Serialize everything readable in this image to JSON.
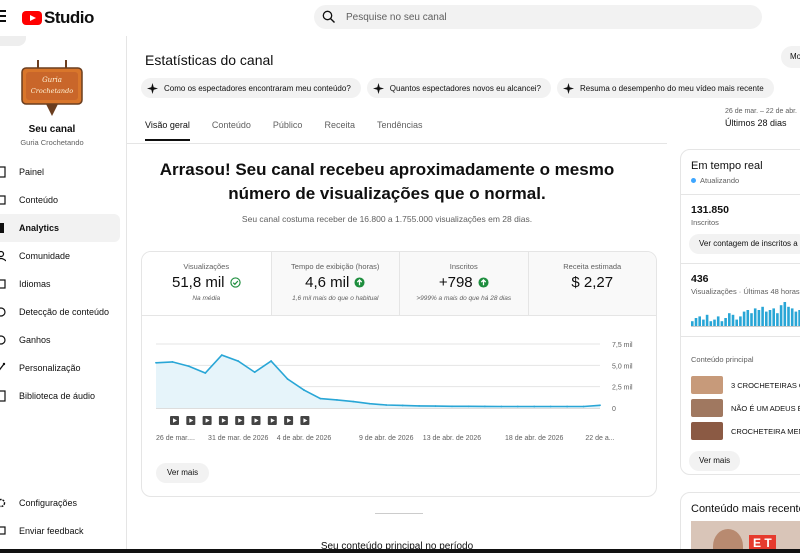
{
  "app": {
    "logo_text": "Studio"
  },
  "search": {
    "placeholder": "Pesquise no seu canal"
  },
  "sidebar": {
    "avatar_text_1": "Guria",
    "avatar_text_2": "Crochetando",
    "channel_label": "Seu canal",
    "channel_name": "Guria Crochetando",
    "items": [
      {
        "label": "Painel",
        "icon": "dashboard-icon"
      },
      {
        "label": "Conteúdo",
        "icon": "content-icon"
      },
      {
        "label": "Analytics",
        "icon": "analytics-icon",
        "active": true
      },
      {
        "label": "Comunidade",
        "icon": "community-icon"
      },
      {
        "label": "Idiomas",
        "icon": "subtitles-icon"
      },
      {
        "label": "Detecção de conteúdo",
        "icon": "copyright-icon"
      },
      {
        "label": "Ganhos",
        "icon": "earn-icon"
      },
      {
        "label": "Personalização",
        "icon": "magic-icon"
      },
      {
        "label": "Biblioteca de áudio",
        "icon": "audio-library-icon"
      }
    ],
    "bottom_items": [
      {
        "label": "Configurações",
        "icon": "gear-icon"
      },
      {
        "label": "Enviar feedback",
        "icon": "feedback-icon"
      }
    ]
  },
  "main": {
    "title": "Estatísticas do canal",
    "more_button": "Mo",
    "chips": [
      "Como os espectadores encontraram meu conteúdo?",
      "Quantos espectadores novos eu alcancei?",
      "Resuma o desempenho do meu vídeo mais recente"
    ],
    "tabs": [
      "Visão geral",
      "Conteúdo",
      "Público",
      "Receita",
      "Tendências"
    ],
    "date_small": "26 de mar. – 22 de abr.",
    "date_range": "Últimos 28 dias",
    "headline_1": "Arrasou! Seu canal recebeu aproximadamente o mesmo",
    "headline_2": "número de visualizações que o normal.",
    "subline": "Seu canal costuma receber de 16.800 a 1.755.000 visualizações em 28 dias.",
    "metrics": [
      {
        "label": "Visualizações",
        "value": "51,8 mil",
        "note": "Na média",
        "badge": "check-circle-icon"
      },
      {
        "label": "Tempo de exibição (horas)",
        "value": "4,6 mil",
        "note": "1,6 mil mais do que o habitual",
        "badge": "arrow-up-icon"
      },
      {
        "label": "Inscritos",
        "value": "+798",
        "note": ">999% a mais do que há 28 dias",
        "badge": "arrow-up-icon"
      },
      {
        "label": "Receita estimada",
        "value": "$ 2,27",
        "note": ""
      }
    ],
    "see_more": "Ver mais",
    "bottom_title": "Seu conteúdo principal no período",
    "colors": {
      "accent": "#0f0f0f",
      "chart_line": "#29a6d6",
      "chart_fill": "#e6f4fa",
      "green": "#1e8e3e",
      "red": "#ff0000"
    }
  },
  "chart_data": {
    "type": "area",
    "x_tick_labels": [
      "26 de mar....",
      "31 de mar. de 2026",
      "4 de abr. de 2026",
      "9 de abr. de 2026",
      "13 de abr. de 2026",
      "18 de abr. de 2026",
      "22 de a..."
    ],
    "x_tick_index": [
      0,
      5,
      9,
      14,
      18,
      23,
      27
    ],
    "y_tick_labels": [
      "7,5 mil",
      "5,0 mil",
      "2,5 mil",
      "0"
    ],
    "y_ticks": [
      7500,
      5000,
      2500,
      0
    ],
    "ylim": [
      0,
      7500
    ],
    "series": [
      {
        "values": [
          5300,
          5400,
          4900,
          4100,
          6200,
          5500,
          4200,
          5500,
          3400,
          2100,
          1100,
          950,
          750,
          500,
          350,
          300,
          250,
          220,
          200,
          200,
          190,
          180,
          180,
          170,
          180,
          170,
          180,
          320
        ]
      }
    ],
    "video_markers": 9
  },
  "realtime": {
    "title": "Em tempo real",
    "status": "Atualizando",
    "subs_value": "131.850",
    "subs_label": "Inscritos",
    "subs_button": "Ver contagem de inscritos a",
    "views_value": "436",
    "views_label": "Visualizações · Últimas 48 horas",
    "bars": [
      3,
      5,
      6,
      4,
      7,
      3,
      4,
      6,
      3,
      5,
      8,
      7,
      4,
      6,
      9,
      10,
      8,
      11,
      10,
      12,
      9,
      10,
      11,
      8,
      13,
      15,
      12,
      11,
      9,
      10,
      8,
      7
    ],
    "top_content_label": "Conteúdo principal",
    "videos": [
      {
        "title": "3 CROCHETEIRAS QU",
        "thumb_color": "#c79a7a"
      },
      {
        "title": "NÃO É UM ADEUS É",
        "thumb_color": "#a07860"
      },
      {
        "title": "CROCHETEIRA MENT",
        "thumb_color": "#8b5a44"
      }
    ],
    "see_more": "Ver mais"
  },
  "recent": {
    "title": "Conteúdo mais recente",
    "thumb_text": "E T"
  }
}
